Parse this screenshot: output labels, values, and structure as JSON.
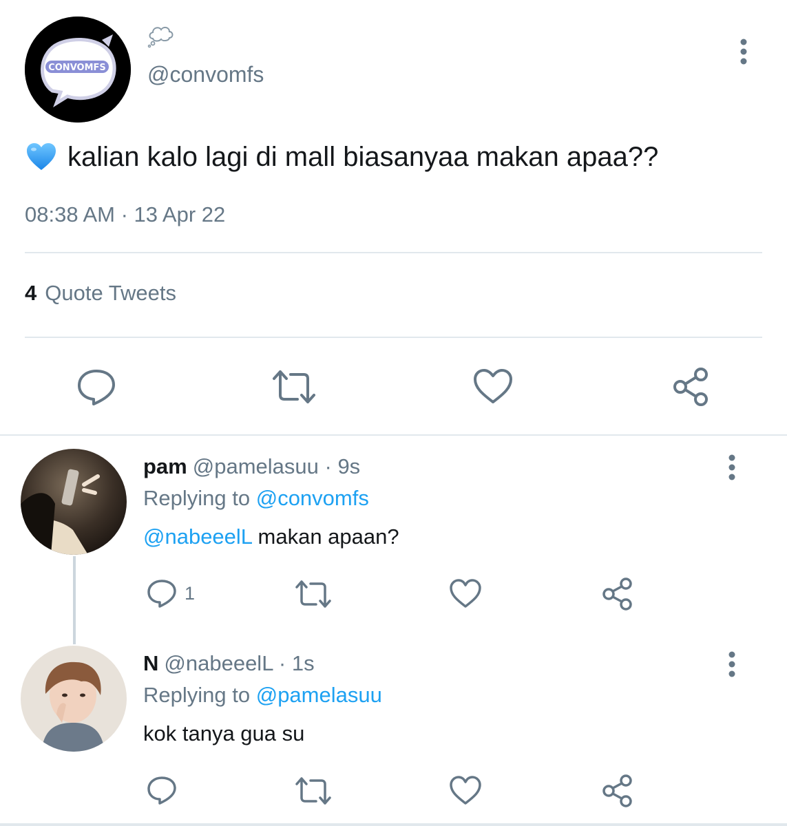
{
  "main_tweet": {
    "handle": "@convomfs",
    "avatar_text": "CONVOMFS",
    "text": "kalian kalo lagi di mall biasanyaa makan apaa??",
    "time": "08:38 AM",
    "date": "13 Apr 22",
    "timestamp_separator": " · ",
    "quote_count": "4",
    "quote_label": "Quote Tweets"
  },
  "replies": [
    {
      "name": "pam",
      "handle": "@pamelasuu",
      "age": "9s",
      "replying_label": "Replying to",
      "replying_to": "@convomfs",
      "mention": "@nabeeelL",
      "text": " makan apaan?",
      "reply_count": "1"
    },
    {
      "name": "N",
      "handle": "@nabeeelL",
      "age": "1s",
      "replying_label": "Replying to",
      "replying_to": "@pamelasuu",
      "mention": "",
      "text": "kok tanya gua su",
      "reply_count": ""
    }
  ],
  "colors": {
    "link": "#1da1f2",
    "secondary_text": "#657786",
    "divider": "#e1e8ed"
  },
  "icons": [
    "thought-bubble-icon",
    "more-vertical-icon",
    "blue-heart-emoji",
    "reply-icon",
    "retweet-icon",
    "like-icon",
    "share-icon"
  ]
}
